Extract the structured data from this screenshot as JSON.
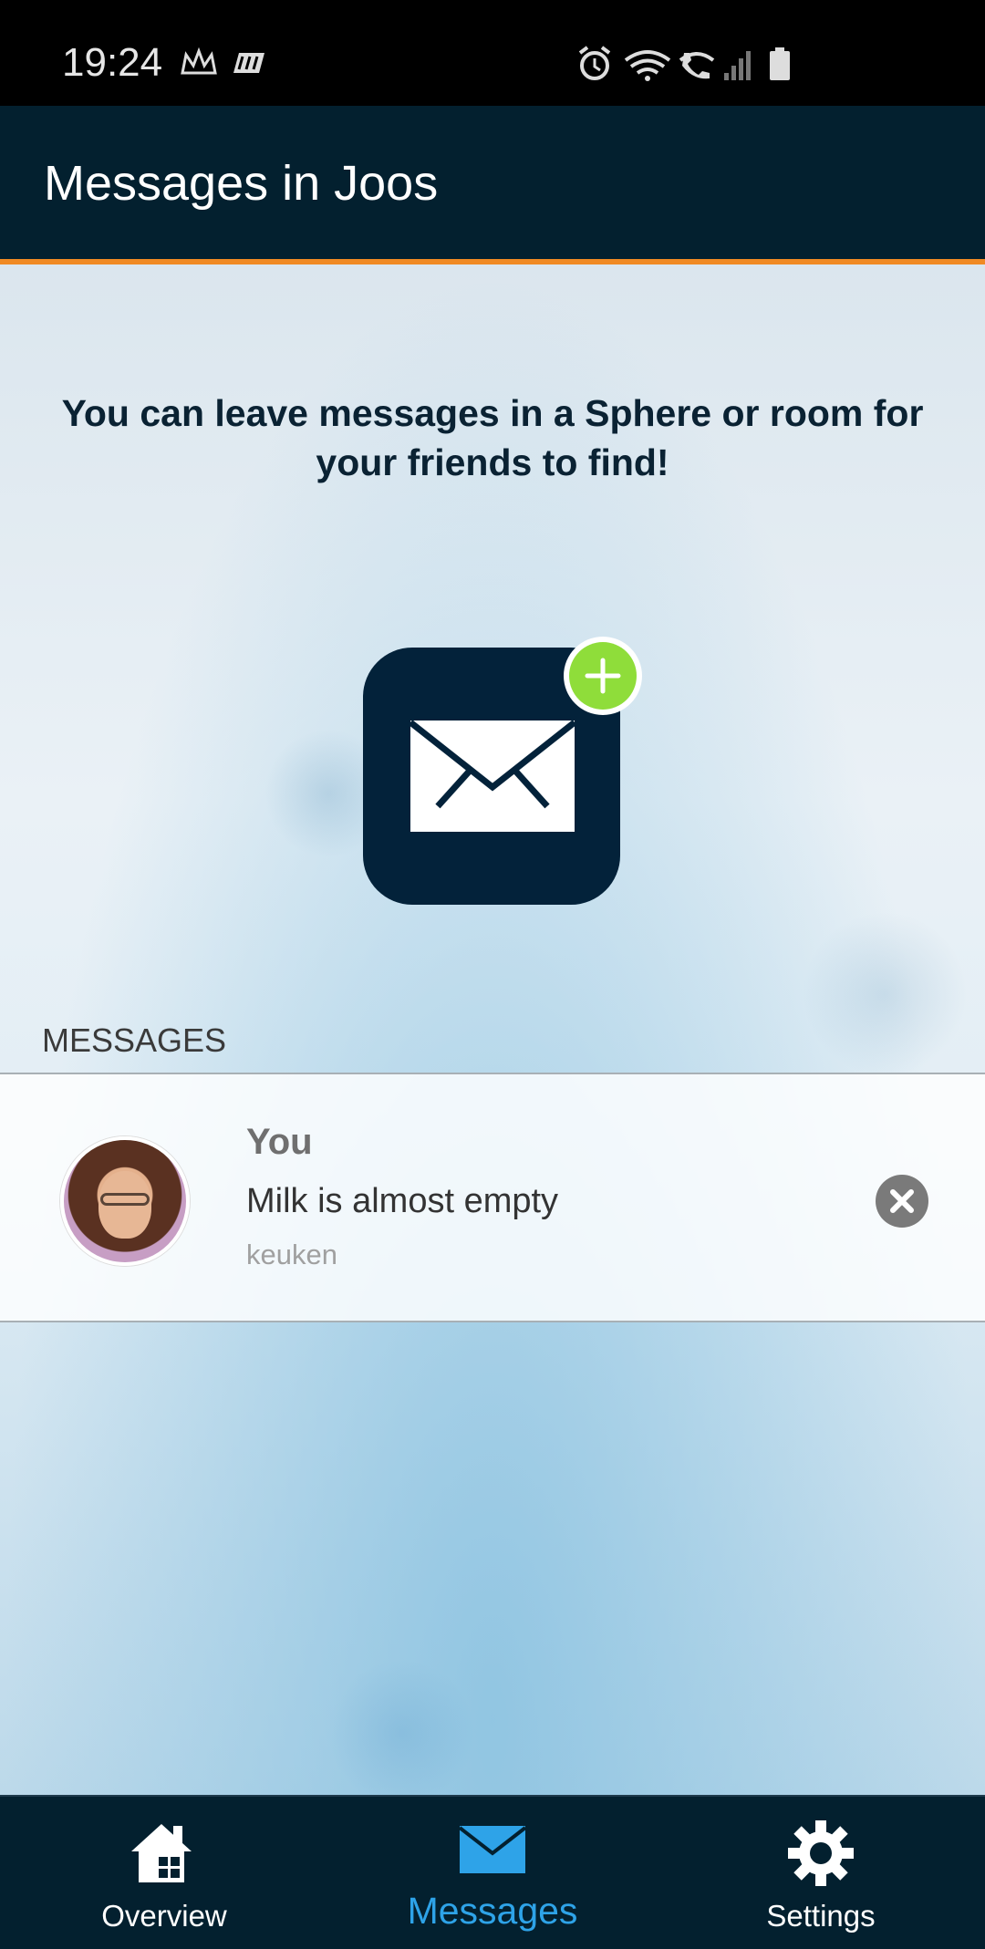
{
  "status_bar": {
    "time": "19:24",
    "left_icons": [
      "crown-icon",
      "app-notification-icon"
    ],
    "right_icons": [
      "alarm-icon",
      "wifi-icon",
      "wifi-call-icon",
      "signal-icon",
      "battery-icon"
    ]
  },
  "app_bar": {
    "title": "Messages in Joos"
  },
  "intro": {
    "text": "You can leave messages in a Sphere or room for your friends to find!"
  },
  "add_message": {
    "icon": "mail-icon",
    "badge_icon": "plus-icon"
  },
  "messages_section": {
    "label": "MESSAGES",
    "items": [
      {
        "author": "You",
        "text": "Milk is almost empty",
        "location": "keuken"
      }
    ]
  },
  "tab_bar": {
    "tabs": [
      {
        "label": "Overview",
        "icon": "home-icon",
        "active": false
      },
      {
        "label": "Messages",
        "icon": "mail-icon",
        "active": true
      },
      {
        "label": "Settings",
        "icon": "gear-icon",
        "active": false
      }
    ]
  },
  "colors": {
    "header_bg": "#03202f",
    "accent_orange": "#f08a24",
    "badge_green": "#8fdd3a",
    "active_tab": "#2ea3e8"
  }
}
